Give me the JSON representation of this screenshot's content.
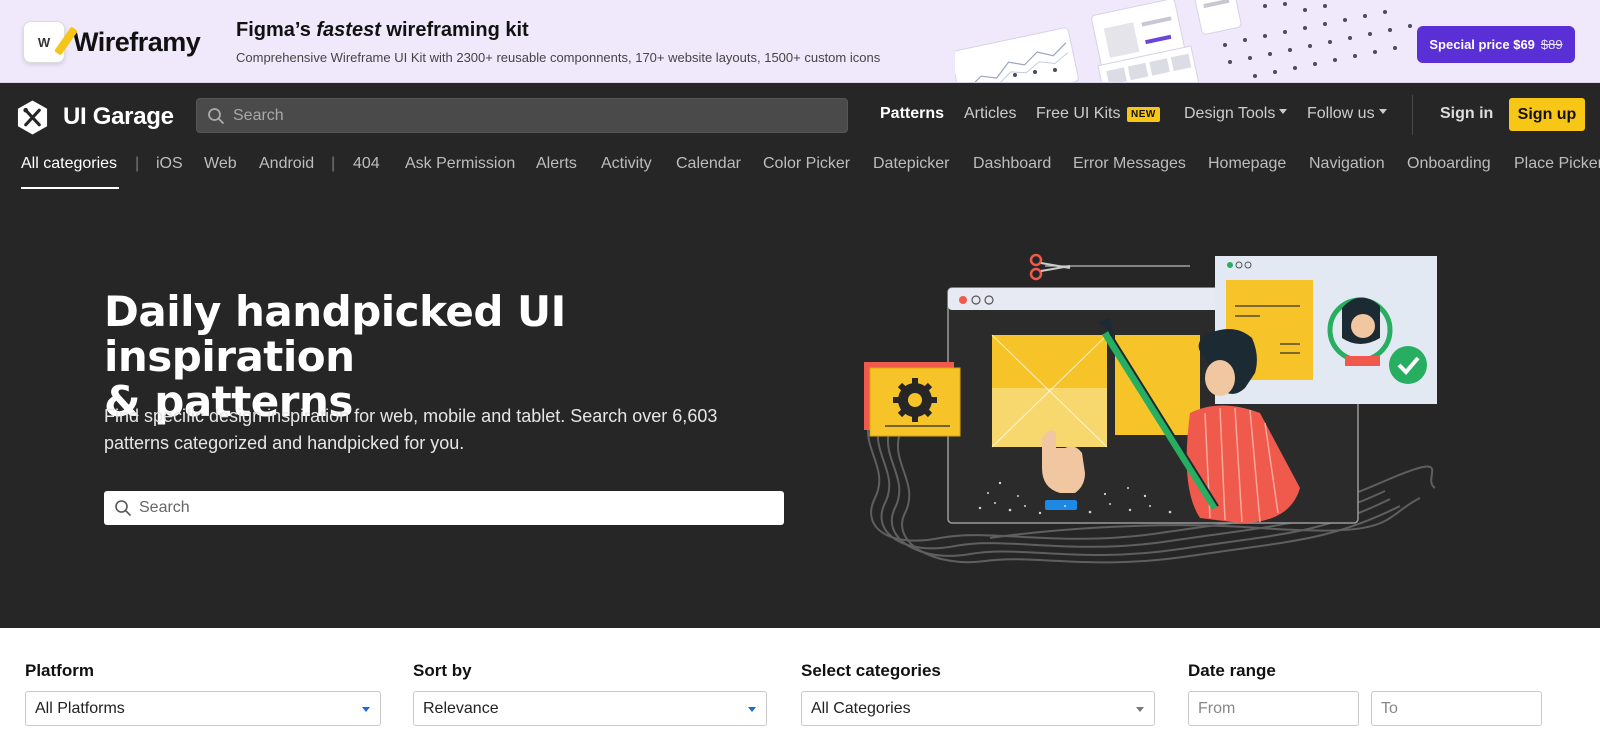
{
  "promo": {
    "brand": "Wireframy",
    "logo_letter": "W",
    "title_prefix": "Figma’s ",
    "title_emphasis": "fastest",
    "title_suffix": " wireframing kit",
    "subtitle": "Comprehensive Wireframe UI Kit with 2300+ reusable componnents, 170+ website layouts, 1500+ custom icons",
    "button_label": "Special price $69",
    "button_old_price": "$89",
    "colors": {
      "background": "#efe9fb",
      "button": "#5a2fd6"
    }
  },
  "header": {
    "logo_text": "UI Garage",
    "search_placeholder": "Search",
    "nav": [
      {
        "label": "Patterns",
        "active": true
      },
      {
        "label": "Articles"
      },
      {
        "label": "Free UI Kits",
        "badge": "NEW"
      },
      {
        "label": "Design Tools",
        "dropdown": true
      },
      {
        "label": "Follow us",
        "dropdown": true
      }
    ],
    "sign_in": "Sign in",
    "sign_up": "Sign up",
    "colors": {
      "background": "#262626",
      "accent": "#f8c715"
    }
  },
  "categories": {
    "all": "All categories",
    "platforms": [
      "iOS",
      "Web",
      "Android"
    ],
    "items": [
      "404",
      "Ask Permission",
      "Alerts",
      "Activity",
      "Calendar",
      "Color Picker",
      "Datepicker",
      "Dashboard",
      "Error Messages",
      "Homepage",
      "Navigation",
      "Onboarding",
      "Place Picker"
    ],
    "separator": "|"
  },
  "hero": {
    "title_line1": "Daily handpicked UI inspiration",
    "title_line2": "& patterns",
    "subtitle": "Find specific design inspiration for web, mobile and tablet. Search over 6,603 patterns categorized and handpicked for you.",
    "search_placeholder": "Search"
  },
  "filters": {
    "platform": {
      "label": "Platform",
      "value": "All Platforms"
    },
    "sort": {
      "label": "Sort by",
      "value": "Relevance"
    },
    "categories": {
      "label": "Select categories",
      "value": "All Categories"
    },
    "date": {
      "label": "Date range",
      "from_placeholder": "From",
      "to_placeholder": "To"
    }
  }
}
